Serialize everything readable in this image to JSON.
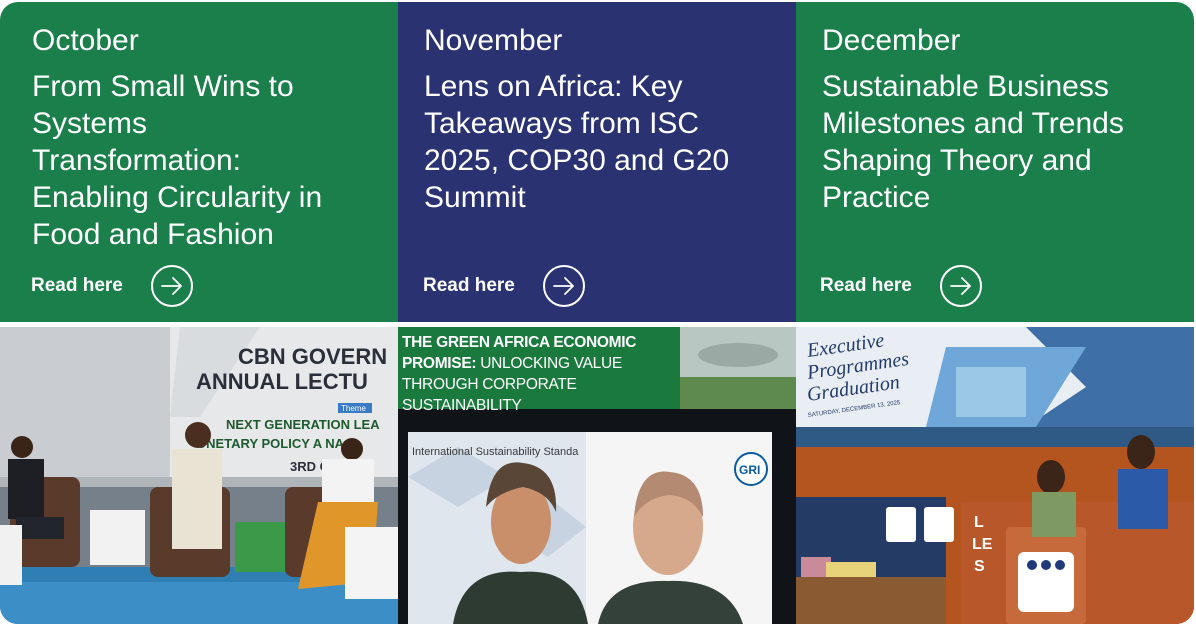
{
  "cards": [
    {
      "month": "October",
      "title_lines": [
        "From Small Wins to",
        "Systems",
        "Transformation:",
        "Enabling Circularity in",
        "Food and Fashion"
      ],
      "cta": "Read here"
    },
    {
      "month": "November",
      "title_lines": [
        "Lens on Africa: Key",
        "Takeaways from ISC",
        "2025, COP30 and G20",
        "Summit"
      ],
      "cta": "Read here"
    },
    {
      "month": "December",
      "title_lines": [
        "Sustainable Business",
        "Milestones and Trends",
        "Shaping Theory and",
        "Practice"
      ],
      "cta": "Read here"
    }
  ],
  "photos": {
    "october": {
      "stage_heading_1": "CBN GOVERN",
      "stage_heading_2": "ANNUAL LECTU",
      "stage_badge": "Theme",
      "stage_theme_1": "NEXT GENERATION LEA",
      "stage_theme_2": "ONETARY POLICY A  NA",
      "stage_date": "3RD O"
    },
    "november": {
      "banner_line_1": "THE GREEN AFRICA ECONOMIC",
      "banner_line_2_bold": "PROMISE:",
      "banner_line_2_rest": " UNLOCKING VALUE",
      "banner_line_3": "THROUGH CORPORATE SUSTAINABILITY",
      "video_left_caption": "International Sustainability Standa",
      "video_right_badge": "GRI"
    },
    "december": {
      "banner_line_1": "Executive",
      "banner_line_2": "Programmes",
      "banner_line_3": "Graduation",
      "banner_date": "SATURDAY, DECEMBER 13, 2025",
      "podium_text": "L",
      "podium_text_2": "LE",
      "podium_text_3": "S"
    }
  },
  "colors": {
    "green": "#1b7f4b",
    "navy": "#2a3272",
    "white": "#ffffff"
  }
}
